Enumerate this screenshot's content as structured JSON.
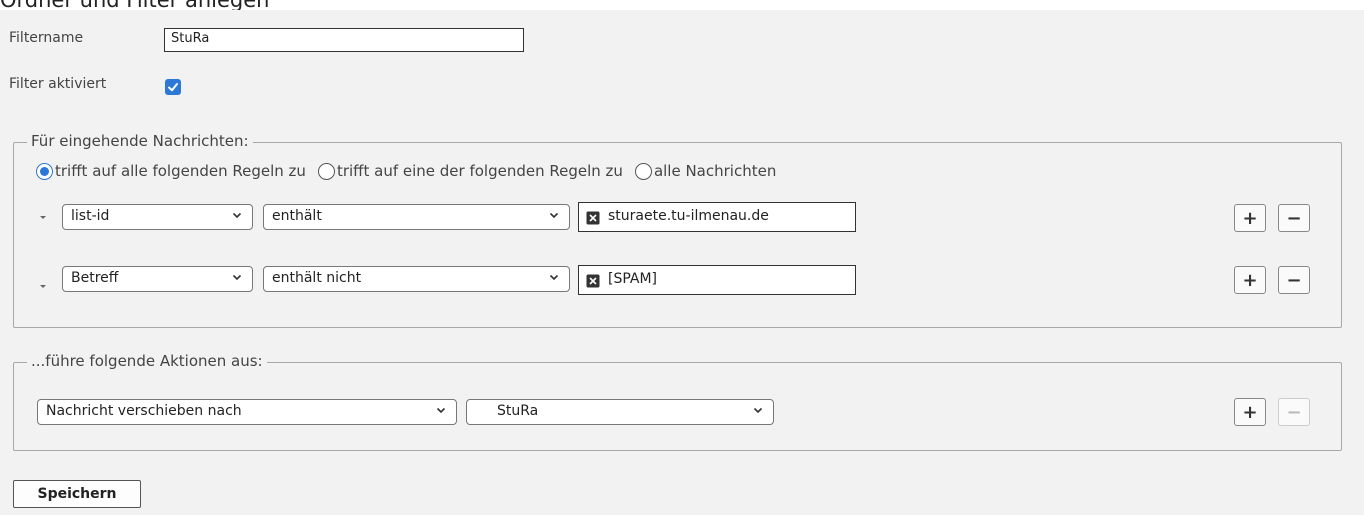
{
  "page_heading": "Ordner und Filter anlegen",
  "filter_name": {
    "label": "Filtername",
    "value": "StuRa"
  },
  "filter_active": {
    "label": "Filter aktiviert",
    "checked": true
  },
  "incoming": {
    "legend": "Für eingehende Nachrichten:",
    "match_options": [
      {
        "label": "trifft auf alle folgenden Regeln zu",
        "checked": true
      },
      {
        "label": "trifft auf eine der folgenden Regeln zu",
        "checked": false
      },
      {
        "label": "alle Nachrichten",
        "checked": false
      }
    ],
    "rules": [
      {
        "field": "list-id",
        "operator": "enthält",
        "value": "sturaete.tu-ilmenau.de"
      },
      {
        "field": "Betreff",
        "operator": "enthält nicht",
        "value": "[SPAM]"
      }
    ]
  },
  "actions": {
    "legend": "...führe folgende Aktionen aus:",
    "items": [
      {
        "action": "Nachricht verschieben nach",
        "target": "StuRa"
      }
    ]
  },
  "buttons": {
    "add": "+",
    "remove": "−",
    "save": "Speichern"
  },
  "colors": {
    "accent": "#2b78d6",
    "panel_bg": "#f2f2f2"
  }
}
